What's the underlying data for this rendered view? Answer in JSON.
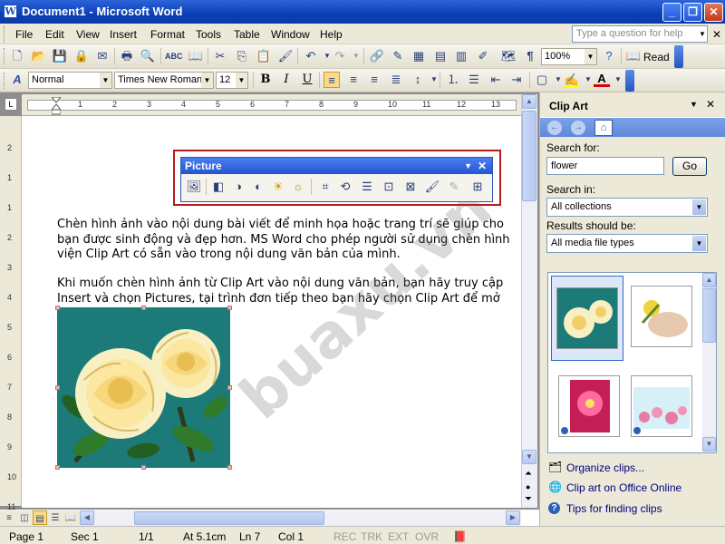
{
  "window": {
    "title": "Document1 - Microsoft Word"
  },
  "menu": {
    "items": [
      "File",
      "Edit",
      "View",
      "Insert",
      "Format",
      "Tools",
      "Table",
      "Window",
      "Help"
    ],
    "ask_placeholder": "Type a question for help"
  },
  "toolbar": {
    "zoom": "100%",
    "read_label": "Read"
  },
  "format": {
    "style": "Normal",
    "font": "Times New Roman",
    "size": "12"
  },
  "ruler": {
    "marks": [
      "1",
      "2",
      "3",
      "4",
      "5",
      "6",
      "7",
      "8",
      "9",
      "10",
      "11",
      "12",
      "13"
    ],
    "vmarks": [
      "2",
      "1",
      "1",
      "2",
      "3",
      "4",
      "5",
      "6",
      "7",
      "8",
      "9",
      "10",
      "11"
    ]
  },
  "picture_toolbar": {
    "title": "Picture"
  },
  "document": {
    "paragraphs": [
      [
        "Chèn hình ảnh vào nội dung bài viết để minh họa hoặc trang trí sẽ giúp cho",
        "bạn được sinh động và đẹp hơn. MS Word cho phép người sử dụng chèn hình",
        "viện Clip Art có sẵn vào trong nội dung văn bản của mình."
      ],
      [
        "Khi muốn chèn hình ảnh từ Clip Art vào nội dung văn bản, bạn hãy truy cập",
        "Insert và chọn Pictures, tại trình đơn tiếp theo bạn hãy chọn Clip Art để mở"
      ]
    ]
  },
  "watermark": "buaxu.vn",
  "clipart_pane": {
    "title": "Clip Art",
    "search_label": "Search for:",
    "search_value": "flower",
    "go_label": "Go",
    "search_in_label": "Search in:",
    "search_in_value": "All collections",
    "results_label": "Results should be:",
    "results_value": "All media file types",
    "links": [
      "Organize clips...",
      "Clip art on Office Online",
      "Tips for finding clips"
    ]
  },
  "status": {
    "page": "Page 1",
    "sec": "Sec 1",
    "pages": "1/1",
    "at": "At 5.1cm",
    "ln": "Ln 7",
    "col": "Col 1",
    "rec": "REC",
    "trk": "TRK",
    "ext": "EXT",
    "ovr": "OVR"
  },
  "colors": {
    "title_bar": "#0a3fb8",
    "toolbar_bg": "#ece9d8",
    "highlight_box": "#b71c1c",
    "link": "#000080"
  }
}
